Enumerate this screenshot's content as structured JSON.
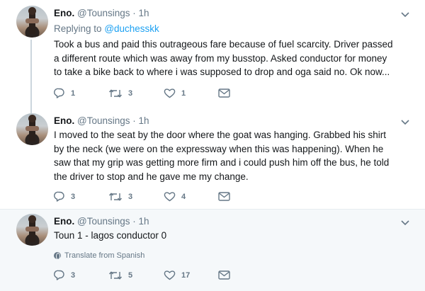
{
  "tweets": [
    {
      "name": "Eno.",
      "handle": "@Tounsings",
      "dot": "·",
      "time": "1h",
      "replying_prefix": "Replying to",
      "replying_mention": "@duchesskk",
      "text": "Took a bus and paid this outrageous fare because of fuel scarcity. Driver passed a different route which was away from my busstop. Asked conductor for money to take a bike back to where i was supposed to drop and oga said no. Ok now...",
      "reply_count": "1",
      "retweet_count": "3",
      "like_count": "1"
    },
    {
      "name": "Eno.",
      "handle": "@Tounsings",
      "dot": "·",
      "time": "1h",
      "text": "I moved to the seat by the door where the goat was hanging. Grabbed his shirt by the neck (we were on the expressway when this was happening). When he saw that my grip was getting more firm and i could push him off the bus, he told the driver to stop and he gave me my change.",
      "reply_count": "3",
      "retweet_count": "3",
      "like_count": "4"
    },
    {
      "name": "Eno.",
      "handle": "@Tounsings",
      "dot": "·",
      "time": "1h",
      "text": "Toun 1 - lagos conductor 0",
      "translate_label": "Translate from Spanish",
      "reply_count": "3",
      "retweet_count": "5",
      "like_count": "17"
    }
  ],
  "icons": {
    "reply": "reply-icon",
    "retweet": "retweet-icon",
    "like": "heart-icon",
    "dm": "envelope-icon",
    "menu": "chevron-down-icon",
    "translate": "globe-icon"
  },
  "colors": {
    "text": "#14171a",
    "muted": "#657786",
    "link": "#1da1f2",
    "focused_bg": "#f5f8fa",
    "thread_line": "#ccd6dd"
  }
}
